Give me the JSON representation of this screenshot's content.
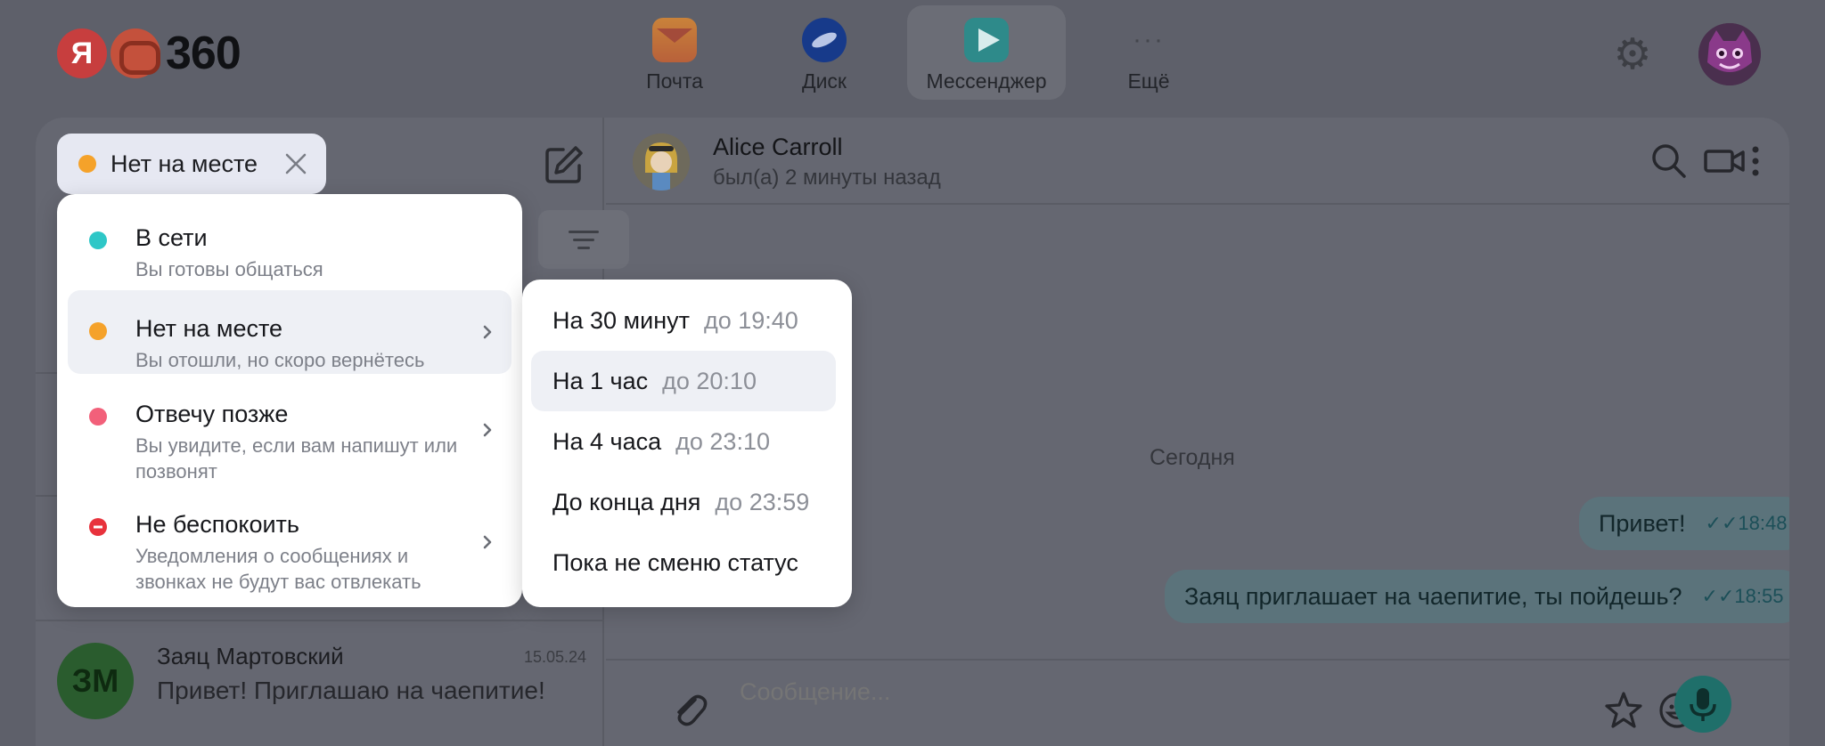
{
  "topbar": {
    "logo_letter": "Я",
    "logo_number": "360",
    "apps": [
      {
        "label": "Почта",
        "icon": "mail-icon"
      },
      {
        "label": "Диск",
        "icon": "disk-icon"
      },
      {
        "label": "Мессенджер",
        "icon": "messenger-icon",
        "active": true
      },
      {
        "label": "Ещё",
        "icon": "more-icon",
        "glyph": "···"
      }
    ],
    "settings_icon": "gear-icon",
    "gear_glyph": "⚙",
    "avatar_icon": "user-avatar"
  },
  "status": {
    "current": "Нет на месте",
    "current_color": "#f5a22a",
    "menu": [
      {
        "title": "В сети",
        "desc": "Вы готовы общаться",
        "color": "#2ec7c7"
      },
      {
        "title": "Нет на месте",
        "desc": "Вы отошли, но скоро вернётесь",
        "color": "#f5a22a"
      },
      {
        "title": "Отвечу позже",
        "desc": "Вы увидите, если вам напишут или позвонят",
        "color": "#f2607a"
      },
      {
        "title": "Не беспокоить",
        "desc": "Уведомления о сообщениях и звонках не будут вас отвлекать",
        "color": "#e8323c"
      }
    ],
    "submenu": [
      {
        "label": "На 30 минут",
        "until": "до 19:40"
      },
      {
        "label": "На 1 час",
        "until": "до 20:10"
      },
      {
        "label": "На 4 часа",
        "until": "до 23:10"
      },
      {
        "label": "До конца дня",
        "until": "до 23:59"
      },
      {
        "label": "Пока не сменю статус",
        "until": ""
      }
    ]
  },
  "sidebar": {
    "chats": [
      {
        "initials": "ЗМ",
        "name": "Заяц Мартовский",
        "date": "15.05.24",
        "preview": "Привет! Приглашаю на чаепитие!"
      }
    ]
  },
  "chat": {
    "contact_name": "Alice Carroll",
    "contact_status": "был(а) 2 минуты назад",
    "date_separator": "Сегодня",
    "messages": [
      {
        "text": "Привет!",
        "time": "18:48",
        "checks": "✓✓"
      },
      {
        "text": "Заяц приглашает на чаепитие, ты пойдешь?",
        "time": "18:55",
        "checks": "✓✓"
      }
    ],
    "input_placeholder": "Сообщение..."
  }
}
